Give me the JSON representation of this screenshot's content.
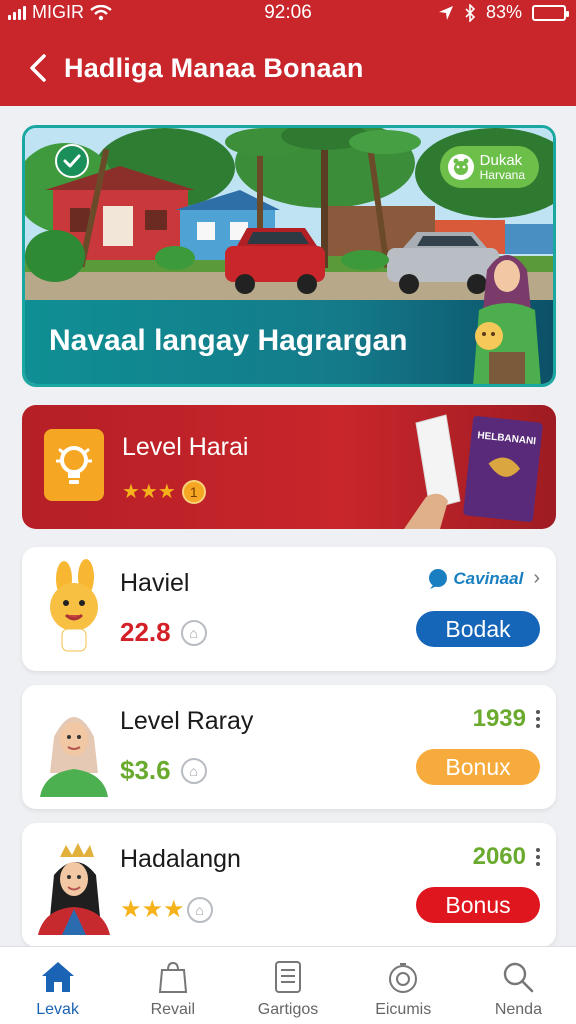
{
  "status": {
    "carrier": "MIGIR",
    "time": "92:06",
    "battery": "83%",
    "battery_level": 0.83
  },
  "header": {
    "title": "Hadliga Manaa Bonaan",
    "back_icon": "chevron-left-icon"
  },
  "hero": {
    "title": "Navaal langay Hagrargan",
    "badge_line1": "Dukak",
    "badge_line2": "Harvana",
    "check_icon": "check-circle-icon"
  },
  "level_banner": {
    "title": "Level Harai",
    "stars": 3,
    "coin_label": "1",
    "product_label": "HELBANANI"
  },
  "cards": [
    {
      "name": "Haviel",
      "value": "22.8",
      "value_color": "#d32027",
      "brand": "Cavinaal",
      "button": "Bodak",
      "button_color": "#1565b8"
    },
    {
      "name": "Level Raray",
      "value": "$3.6",
      "value_color": "#6aaa2e",
      "number": "1939",
      "button": "Bonux",
      "button_color": "#f6ab3c"
    },
    {
      "name": "Hadalangn",
      "stars": 3,
      "number": "2060",
      "button": "Bonus",
      "button_color": "#e0161f"
    }
  ],
  "bottom_nav": [
    {
      "label": "Levak",
      "icon": "home-icon",
      "active": true
    },
    {
      "label": "Revail",
      "icon": "bag-icon",
      "active": false
    },
    {
      "label": "Gartigos",
      "icon": "document-icon",
      "active": false
    },
    {
      "label": "Eicumis",
      "icon": "coin-icon",
      "active": false
    },
    {
      "label": "Nenda",
      "icon": "search-icon",
      "active": false
    }
  ],
  "colors": {
    "header_red": "#c8262b",
    "hero_teal": "#1aa7a0",
    "active_blue": "#1b63b5"
  }
}
